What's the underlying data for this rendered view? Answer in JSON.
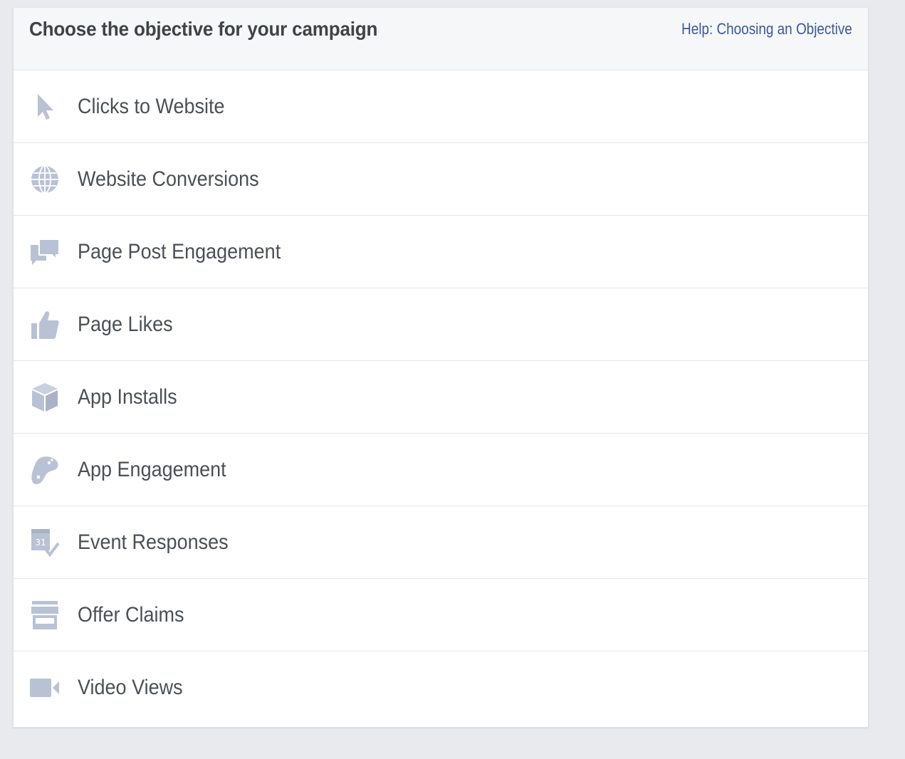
{
  "header": {
    "title": "Choose the objective for your campaign",
    "help_link": "Help: Choosing an Objective"
  },
  "colors": {
    "icon": "#b9c2d4",
    "link": "#3b5998",
    "text": "#4b4f56",
    "background": "#e9eaed"
  },
  "objectives": [
    {
      "label": "Clicks to Website",
      "icon": "cursor-icon"
    },
    {
      "label": "Website Conversions",
      "icon": "globe-icon"
    },
    {
      "label": "Page Post Engagement",
      "icon": "speech-bubbles-icon"
    },
    {
      "label": "Page Likes",
      "icon": "thumbs-up-icon"
    },
    {
      "label": "App Installs",
      "icon": "box-icon"
    },
    {
      "label": "App Engagement",
      "icon": "game-controller-icon"
    },
    {
      "label": "Event Responses",
      "icon": "calendar-icon"
    },
    {
      "label": "Offer Claims",
      "icon": "storefront-icon"
    },
    {
      "label": "Video Views",
      "icon": "video-camera-icon"
    }
  ]
}
